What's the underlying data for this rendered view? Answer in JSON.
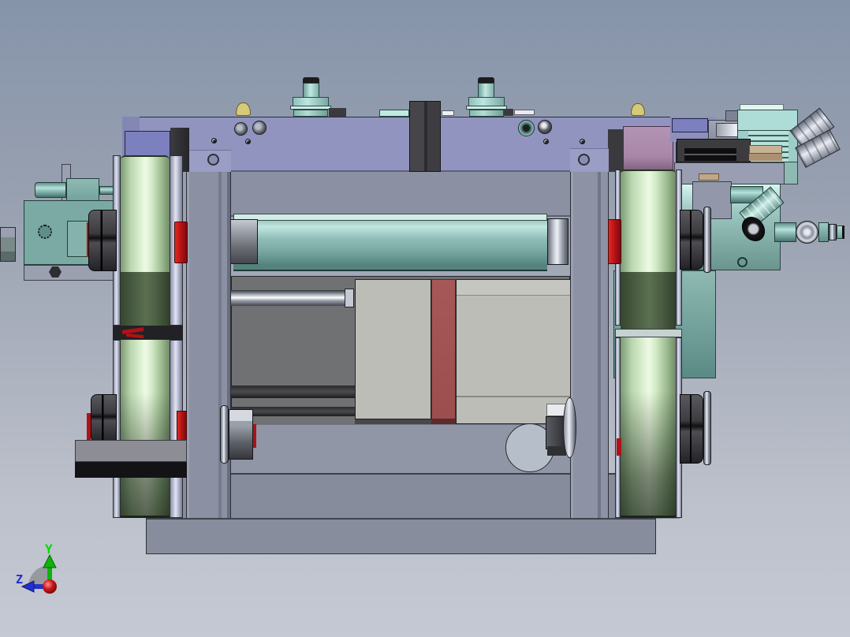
{
  "app": {
    "name": "cad-viewport",
    "description": "3D CAD assembly model, front orthographic view"
  },
  "background": {
    "top": "#8694aa",
    "mid": "#aab0bd",
    "bottom": "#c5c9d3"
  },
  "triad": {
    "x": {
      "color": "#d01818"
    },
    "y": {
      "label": "Y",
      "color": "#00dc00"
    },
    "z": {
      "label": "Z",
      "color": "#2430cc"
    },
    "arc_color": "#8f9197"
  },
  "parts": {
    "back_panel": {
      "color": "#6f7173"
    },
    "mid_beam": {
      "color": "#8b90a2"
    },
    "lower_beam": {
      "color": "#9096a6"
    },
    "bottom_beam": {
      "color": "#868c9c"
    },
    "base_plate": {
      "color": "#888d9d"
    },
    "left_column": {
      "color": "#8b90a2"
    },
    "right_column": {
      "color": "#8d92a4"
    },
    "top_plate": {
      "color": "#9194bf"
    },
    "slider_body": {
      "color": "#bdbdb7"
    },
    "slider_stripe": {
      "color": "#a35757"
    },
    "roller_tube": {
      "color": "#7fb3ad"
    },
    "roller_highlight": {
      "color": "#d2ece8"
    },
    "guide_rod": {
      "color": "#e8eaf0"
    },
    "wheel_green_light": {
      "color": "#dff2d6"
    },
    "wheel_green_dark": {
      "color": "#4e6449"
    },
    "wheel_rim": {
      "color": "#c9cde0"
    },
    "red_hub": {
      "color": "#c41316"
    },
    "bearing_hub": {
      "color": "#3c3c40"
    },
    "left_plate": {
      "color": "#7ba9a3"
    },
    "left_cylinder": {
      "color": "#8fc2bc"
    },
    "right_plate": {
      "color": "#7fa9a3"
    },
    "air_cylinder": {
      "color": "#aedcd6"
    },
    "cylinder_stripe": {
      "color": "#3f5f5b"
    },
    "chrome_fitting": {
      "color": "#e8ecf4"
    },
    "dark_block": {
      "color": "#3c3c3e"
    },
    "tan_spacer": {
      "color": "#c8b294"
    },
    "mauve_block": {
      "color": "#b394b3"
    },
    "blue_block": {
      "color": "#7c80be"
    },
    "lavender_step": {
      "color": "#9a9dc4"
    },
    "yellow_plug": {
      "color": "#d6c97a"
    },
    "hex_nut": {
      "color": "#9aa0aa"
    },
    "cutout_circle": {
      "color": "#b6bec9"
    },
    "bracket_dark": {
      "color": "#131316"
    },
    "teal_bolt": {
      "color": "#9ccfc9"
    }
  }
}
